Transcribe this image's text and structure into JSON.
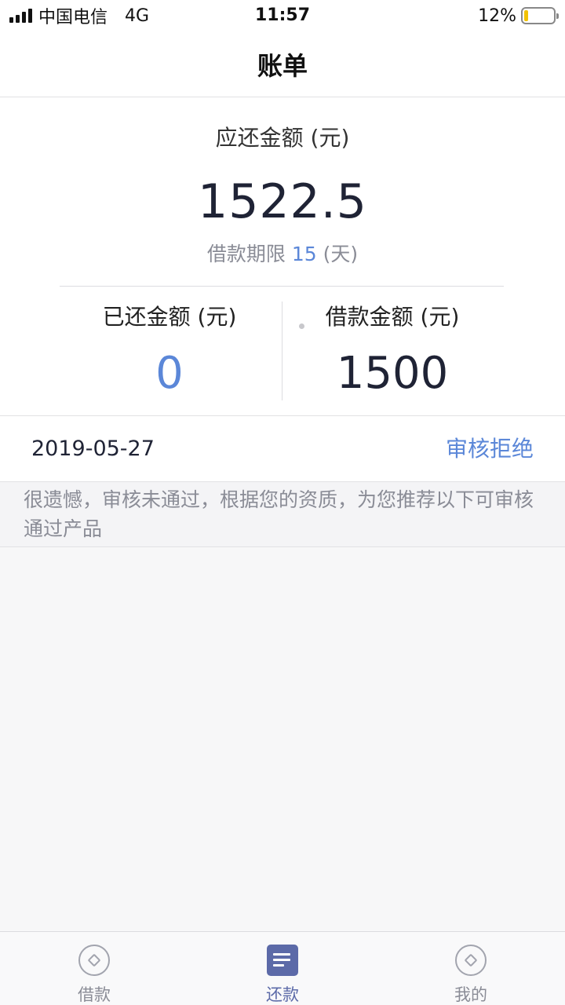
{
  "status_bar": {
    "carrier": "中国电信",
    "network": "4G",
    "time": "11:57",
    "battery_text": "12%",
    "battery_level": 0.12
  },
  "header": {
    "title": "账单"
  },
  "summary": {
    "due_label": "应还金额 (元)",
    "due_amount": "1522.5",
    "term_prefix": "借款期限 ",
    "term_value": "15",
    "term_suffix": " (天)",
    "repaid_label": "已还金额 (元)",
    "repaid_value": "0",
    "loan_label": "借款金额 (元)",
    "loan_value": "1500"
  },
  "record": {
    "date": "2019-05-27",
    "status": "审核拒绝"
  },
  "notice": {
    "text": "很遗憾，审核未通过，根据您的资质，为您推荐以下可审核通过产品"
  },
  "tabs": [
    {
      "label": "借款",
      "icon": "ring-icon",
      "active": false
    },
    {
      "label": "还款",
      "icon": "document-icon",
      "active": true
    },
    {
      "label": "我的",
      "icon": "ring-icon",
      "active": false
    }
  ],
  "colors": {
    "accent_blue": "#5b87d8",
    "tab_active": "#5c6aa8",
    "muted_text": "#8a8c96",
    "battery": "#f2c200"
  }
}
